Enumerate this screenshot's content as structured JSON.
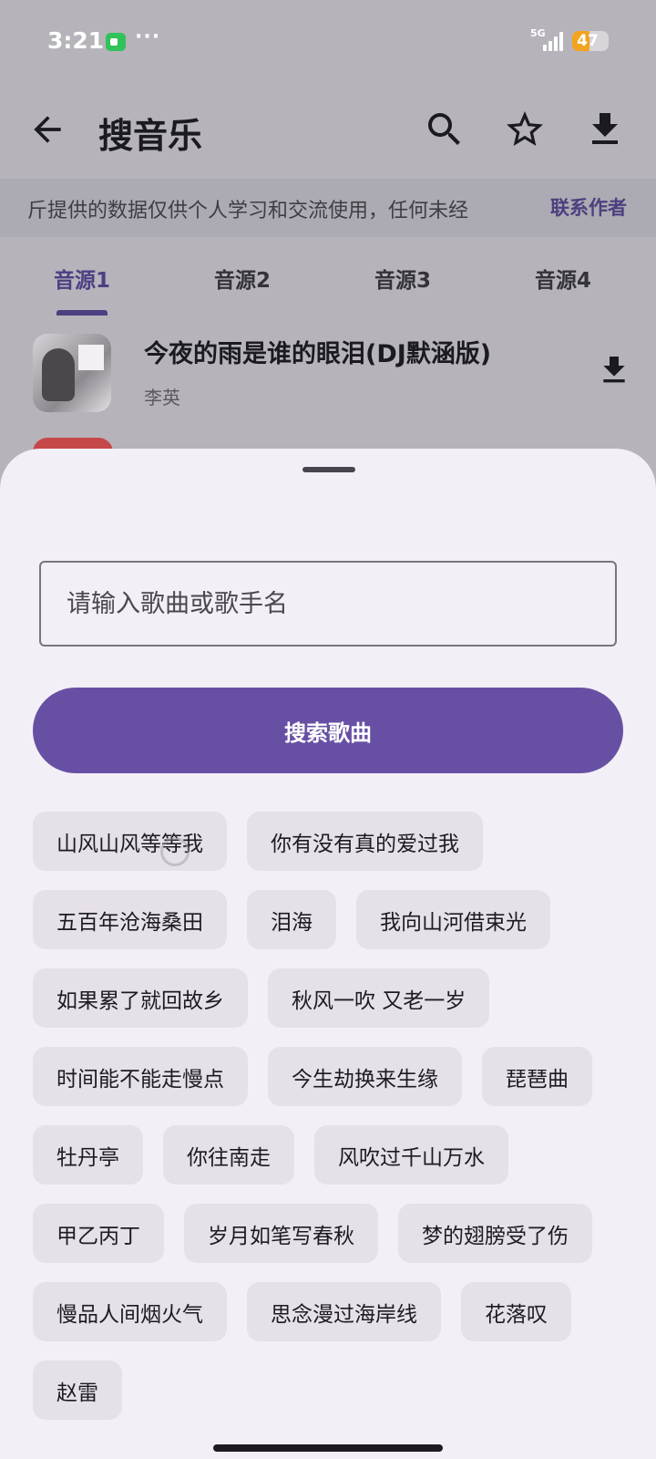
{
  "status_bar": {
    "time": "3:21",
    "more": "···",
    "network": "5G",
    "battery": "47",
    "battery_level": 0.47
  },
  "app_bar": {
    "title": "搜音乐",
    "back_icon": "arrow-back-icon",
    "actions": [
      "search-icon",
      "star-icon",
      "download-icon"
    ]
  },
  "notice": {
    "text": "斤提供的数据仅供个人学习和交流使用，任何未经",
    "contact_label": "联系作者"
  },
  "tabs": [
    "音源1",
    "音源2",
    "音源3",
    "音源4"
  ],
  "active_tab": 0,
  "songs": [
    {
      "title": "今夜的雨是谁的眼泪(DJ默涵版)",
      "artist": "李英"
    }
  ],
  "sheet": {
    "input_placeholder": "请输入歌曲或歌手名",
    "search_button": "搜索歌曲",
    "suggestions": [
      "山风山风等等我",
      "你有没有真的爱过我",
      "五百年沧海桑田",
      "泪海",
      "我向山河借束光",
      "如果累了就回故乡",
      "秋风一吹 又老一岁",
      "时间能不能走慢点",
      "今生劫换来生缘",
      "琵琶曲",
      "牡丹亭",
      "你往南走",
      "风吹过千山万水",
      "甲乙丙丁",
      "岁月如笔写春秋",
      "梦的翅膀受了伤",
      "慢品人间烟火气",
      "思念漫过海岸线",
      "花落叹",
      "赵雷"
    ]
  },
  "colors": {
    "primary": "#6750a4",
    "scrim": "#b7b3bb",
    "sheet": "#f3eff6",
    "chip": "#e6e0e9"
  }
}
